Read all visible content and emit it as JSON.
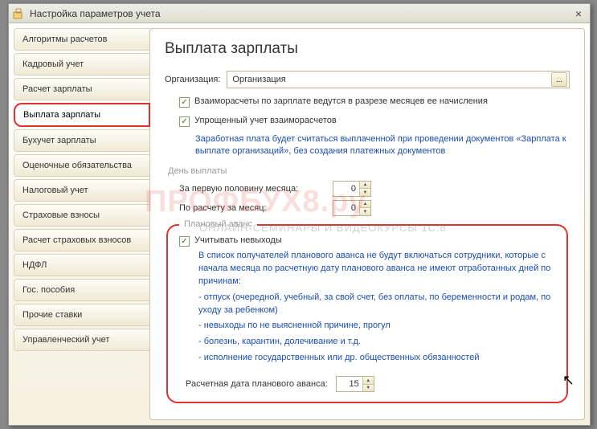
{
  "window": {
    "title": "Настройка параметров учета",
    "close_label": "×"
  },
  "sidebar": {
    "items": [
      {
        "label": "Алгоритмы расчетов"
      },
      {
        "label": "Кадровый учет"
      },
      {
        "label": "Расчет зарплаты"
      },
      {
        "label": "Выплата зарплаты",
        "active": true
      },
      {
        "label": "Бухучет зарплаты"
      },
      {
        "label": "Оценочные обязательства"
      },
      {
        "label": "Налоговый учет"
      },
      {
        "label": "Страховые взносы"
      },
      {
        "label": "Расчет страховых взносов"
      },
      {
        "label": "НДФЛ"
      },
      {
        "label": "Гос. пособия"
      },
      {
        "label": "Прочие ставки"
      },
      {
        "label": "Управленческий учет"
      }
    ]
  },
  "main": {
    "heading": "Выплата зарплаты",
    "org_label": "Организация:",
    "org_value": "Организация",
    "select_btn": "...",
    "cb1_label": "Взаиморасчеты по зарплате ведутся в разрезе месяцев ее начисления",
    "cb2_label": "Упрощенный учет взаиморасчетов",
    "note": "Заработная плата будет считаться выплаченной при проведении документов «Зарплата к выплате организаций», без создания платежных документов",
    "day_group_title": "День выплаты",
    "first_half_label": "За первую половину месяца:",
    "first_half_value": "0",
    "by_calc_label": "По расчету за месяц:",
    "by_calc_value": "0",
    "advance_group_title": "Плановый аванс",
    "cb3_label": "Учитывать невыходы",
    "advance_text_1": "В список получателей планового аванса не будут включаться сотрудники, которые с начала месяца по расчетную дату планового аванса не имеют отработанных дней по причинам:",
    "advance_bullets": [
      "- отпуск (очередной, учебный, за свой счет, без оплаты, по беременности и родам, по уходу за ребенком)",
      "- невыходы по не выясненной причине, прогул",
      "- болезнь, карантин, долечивание и т.д.",
      "- исполнение государственных или др. общественных обязанностей"
    ],
    "advance_date_label": "Расчетная дата планового аванса:",
    "advance_date_value": "15"
  },
  "watermark": {
    "main": "ПРОФБУХ8.ру",
    "sub": "ОНЛАЙН-СЕМИНАРЫ И ВИДЕОКУРСЫ 1С:8"
  }
}
